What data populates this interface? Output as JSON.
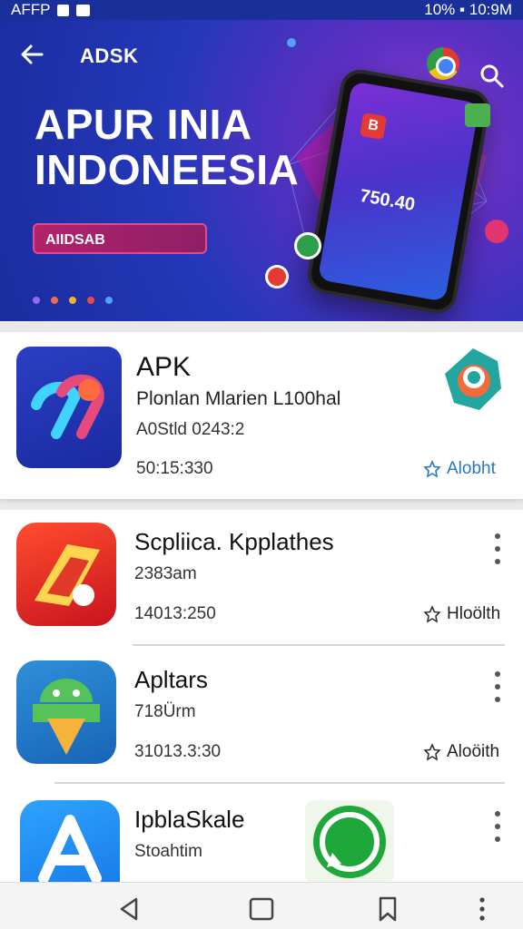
{
  "status_bar": {
    "left_text": "AFFP",
    "right_text": "10% ▪ 10:9M"
  },
  "header": {
    "brand": "ADSK"
  },
  "hero": {
    "title_line1": "APUR INIA",
    "title_line2": "INDONEESIA",
    "pill_label": "AIIDSAB",
    "phone_number": "750.40",
    "phone_icon_letter": "B",
    "dot_colors": [
      "#8e6cf0",
      "#ef6c57",
      "#f0b429",
      "#e94a4a",
      "#4ea3ff"
    ]
  },
  "featured": {
    "title": "APK",
    "subtitle": "Plonlan Mlarien L100hal",
    "meta": "A0Stld 0243:2",
    "time": "50:15:330",
    "action": "Alobht"
  },
  "apps": [
    {
      "title": "Scpliica. Kpplathes",
      "subtitle": "2383am",
      "time": "14013:250",
      "action": "Hloölth"
    },
    {
      "title": "Apltars",
      "subtitle": "718Ürm",
      "time": "31013.3:30",
      "action": "Aloöith"
    },
    {
      "title": "IpblaSkale",
      "subtitle": "Stoahtim",
      "time": "",
      "action": ""
    }
  ],
  "nav": {
    "items": [
      "back",
      "home",
      "bookmarks",
      "more"
    ]
  }
}
